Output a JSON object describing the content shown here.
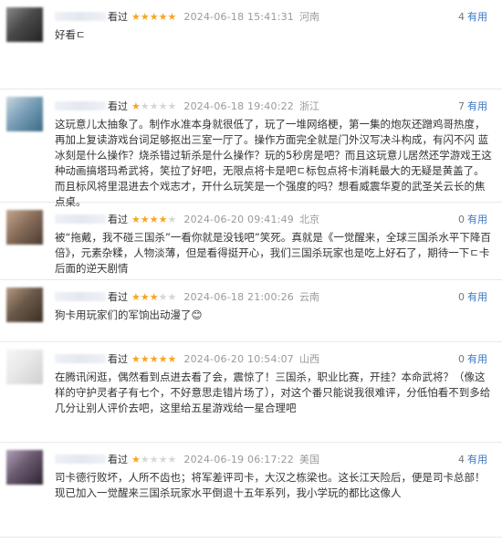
{
  "useful_label": "有用",
  "colors": {
    "star_on": "#f5a623",
    "star_off": "#d6d6d6",
    "link": "#3a78c4"
  },
  "reviews": [
    {
      "user_tail": "看过",
      "rating": 5,
      "date": "2024-06-18 15:41:31",
      "location": "河南",
      "useful_count": "4",
      "text": "好看ㄷ",
      "avatar_colors": [
        "#4a4a4a",
        "#222",
        "#888"
      ]
    },
    {
      "user_tail": "看过",
      "rating": 1,
      "date": "2024-06-18 19:40:22",
      "location": "浙江",
      "useful_count": "7",
      "text": "这玩意儿太抽象了。制作水准本身就很低了，玩了一堆网络梗，第一集的炮灰还蹭鸡哥热度，再加上复读游戏台词足够抠出三室一厅了。操作方面完全就是门外汉写决斗构成，有闪不闪 蓝冰刻是什么操作？烧杀错过斩杀是什么操作？玩的5秒房是吧？而且这玩意儿居然还学游戏王这种动画搞塔玛希武将，笑拉了好吧，无限点将卡是吧ㄷ标包点将卡消耗最大的无疑是黄盖了。而且标风将里混进去个戏志才，开什么玩笑是一个强度的吗？想看威震华夏的武圣关云长的焦点桌。",
      "avatar_colors": [
        "#7aa0b8",
        "#3c6a86",
        "#c9d6df"
      ]
    },
    {
      "user_tail": "看过",
      "rating": 4,
      "date": "2024-06-20 09:41:49",
      "location": "北京",
      "useful_count": "0",
      "text": "被“拖戴，我不碰三国杀”一看你就是没钱吧”笑死。真就是《一觉醒来，全球三国杀水平下降百倍》，元素杂糅，人物淡薄，但是看得挺开心，我们三国杀玩家也是吃上好石了，期待一下ㄷ卡后面的逆天剧情",
      "avatar_colors": [
        "#8a6f5c",
        "#4b3a30",
        "#c3a88e"
      ]
    },
    {
      "user_tail": "看过",
      "rating": 3,
      "date": "2024-06-18 21:00:26",
      "location": "云南",
      "useful_count": "0",
      "text": "狗卡用玩家们的军饷出动漫了😊",
      "avatar_colors": [
        "#6b5a4a",
        "#3a2e24",
        "#b59a80"
      ]
    },
    {
      "user_tail": "看过",
      "rating": 5,
      "date": "2024-06-20 10:54:07",
      "location": "山西",
      "useful_count": "0",
      "text": "在腾讯闲逛，偶然看到点进去看了会，震惊了！三国杀，职业比赛，开挂？本命武将？（像这样的守护灵者子有七个，不好意思走错片场了），对这个番只能说我很难评，分低怕看不到多给几分让别人评价去吧，这里给五星游戏给一星合理吧",
      "avatar_colors": [
        "#e8e8e8",
        "#cfcfcf",
        "#f6f6f6"
      ]
    },
    {
      "user_tail": "看过",
      "rating": 1,
      "date": "2024-06-19 06:17:22",
      "location": "美国",
      "useful_count": "4",
      "text": "司卡德行败坏，人所不齿也；将军差评司卡，大汉之栋梁也。这长江天险后，便是司卡总部！现已加入一觉醒来三国杀玩家水平倒退十五年系列，我小学玩的都比这像人",
      "avatar_colors": [
        "#6a5a70",
        "#2e2430",
        "#b29fb8"
      ]
    }
  ]
}
